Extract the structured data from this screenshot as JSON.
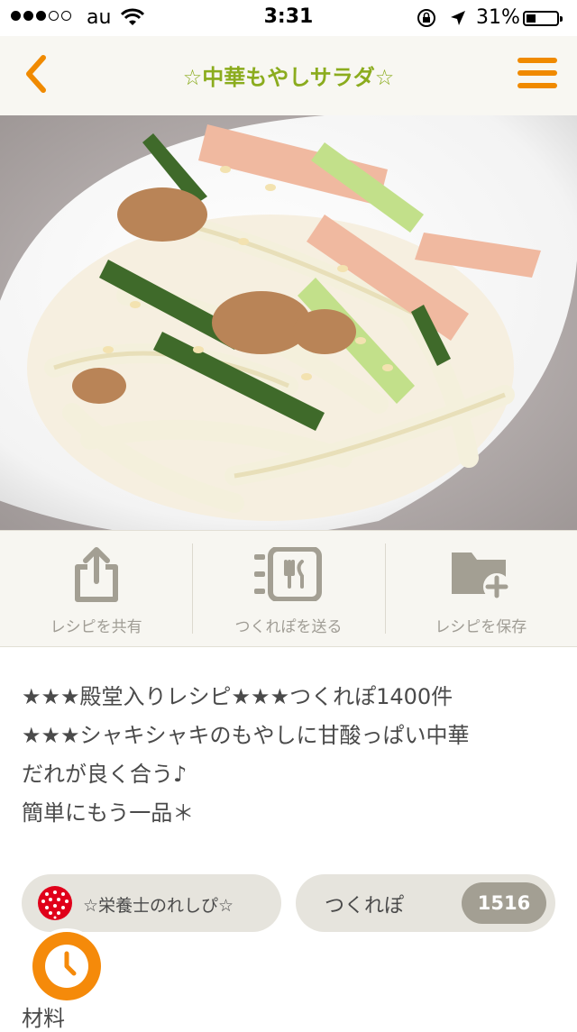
{
  "status_bar": {
    "carrier": "au",
    "time": "3:31",
    "battery": "31%",
    "battery_level": 0.31
  },
  "nav": {
    "title": "☆中華もやしサラダ☆"
  },
  "actions": [
    {
      "label": "レシピを共有",
      "icon": "share-icon"
    },
    {
      "label": "つくれぽを送る",
      "icon": "tsukurepo-icon"
    },
    {
      "label": "レシピを保存",
      "icon": "folder-add-icon"
    }
  ],
  "description": {
    "lines": [
      "★★★殿堂入りレシピ★★★つくれぽ1400件",
      "★★★シャキシャキのもやしに甘酸っぱい中華",
      "だれが良く合う♪",
      "簡単にもう一品＊"
    ]
  },
  "author": {
    "name": "☆栄養士のれしぴ☆"
  },
  "tsukurepo": {
    "label": "つくれぽ",
    "count": "1516"
  },
  "section": {
    "ingredients_label": "材料"
  },
  "colors": {
    "accent_orange": "#f08a00",
    "title_green": "#8bac1e",
    "nav_bg": "#f8f7f2",
    "pill_bg": "#e6e4dd"
  }
}
